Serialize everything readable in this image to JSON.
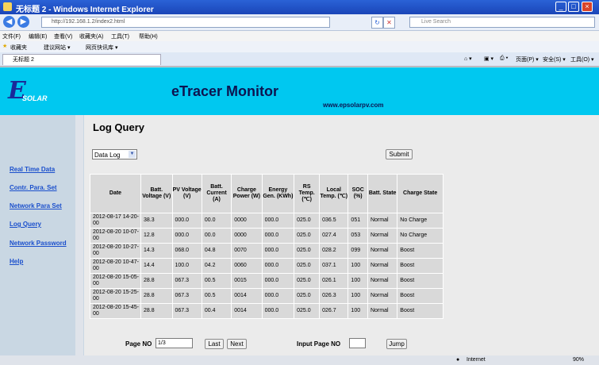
{
  "window": {
    "title": "无标题 2 - Windows Internet Explorer",
    "minimize": "_",
    "maximize": "□",
    "close": "×"
  },
  "address": {
    "url": "http://192.168.1.2/index2.html",
    "search_placeholder": "Live Search"
  },
  "menu": [
    "文件(F)",
    "编辑(E)",
    "查看(V)",
    "收藏夹(A)",
    "工具(T)",
    "帮助(H)"
  ],
  "favorites": {
    "label": "收藏夹",
    "suggested": "建议网站 ▾",
    "gallery": "网页快讯库 ▾"
  },
  "tab": {
    "title": "无标题 2"
  },
  "commands": {
    "page": "页面(P) ▾",
    "safety": "安全(S) ▾",
    "tools": "工具(O) ▾"
  },
  "header": {
    "logo_e": "E",
    "logo_solar": "SOLAR",
    "title": "eTracer Monitor",
    "site": "www.epsolarpv.com"
  },
  "sidebar": {
    "items": [
      "Real Time Data",
      "Contr. Para. Set",
      "Network Para Set",
      "Log Query",
      "Network Password",
      "Help"
    ]
  },
  "main": {
    "title": "Log Query",
    "select_value": "Data Log",
    "submit": "Submit"
  },
  "table": {
    "headers": [
      "Date",
      "Batt. Voltage (V)",
      "PV Voltage (V)",
      "Batt. Current (A)",
      "Charge Power (W)",
      "Energy Gen. (KWh)",
      "RS Temp. (℃)",
      "Local Temp. (℃)",
      "SOC (%)",
      "Batt. State",
      "Charge State"
    ],
    "rows": [
      [
        "2012-08-17 14-20-00",
        "38.3",
        "000.0",
        "00.0",
        "0000",
        "000.0",
        "025.0",
        "036.5",
        "051",
        "Normal",
        "No Charge"
      ],
      [
        "2012-08-20 10-07-00",
        "12.8",
        "000.0",
        "00.0",
        "0000",
        "000.0",
        "025.0",
        "027.4",
        "053",
        "Normal",
        "No Charge"
      ],
      [
        "2012-08-20 10-27-00",
        "14.3",
        "068.0",
        "04.8",
        "0070",
        "000.0",
        "025.0",
        "028.2",
        "099",
        "Normal",
        "Boost"
      ],
      [
        "2012-08-20 10-47-00",
        "14.4",
        "100.0",
        "04.2",
        "0060",
        "000.0",
        "025.0",
        "037.1",
        "100",
        "Normal",
        "Boost"
      ],
      [
        "2012-08-20 15-05-00",
        "28.8",
        "067.3",
        "00.5",
        "0015",
        "000.0",
        "025.0",
        "026.1",
        "100",
        "Normal",
        "Boost"
      ],
      [
        "2012-08-20 15-25-00",
        "28.8",
        "067.3",
        "00.5",
        "0014",
        "000.0",
        "025.0",
        "026.3",
        "100",
        "Normal",
        "Boost"
      ],
      [
        "2012-08-20 15-45-00",
        "28.8",
        "067.3",
        "00.4",
        "0014",
        "000.0",
        "025.0",
        "026.7",
        "100",
        "Normal",
        "Boost"
      ]
    ]
  },
  "pager": {
    "page_label": "Page NO",
    "page_value": "1/3",
    "last": "Last",
    "next": "Next",
    "input_label": "Input Page NO",
    "input_value": "",
    "jump": "Jump"
  },
  "status": {
    "zone": "Internet",
    "zoom": "90%"
  }
}
